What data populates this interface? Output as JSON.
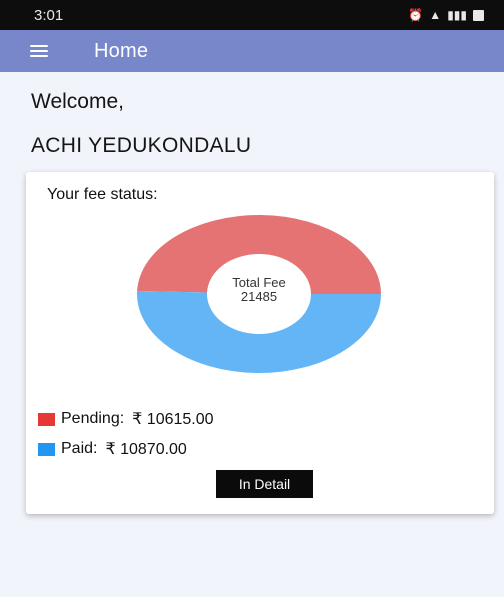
{
  "status_bar": {
    "time": "3:01",
    "icons": [
      "alarm-icon",
      "signal-icon",
      "network-icon",
      "battery-icon"
    ]
  },
  "app_bar": {
    "title": "Home",
    "menu_icon": "hamburger-menu-icon"
  },
  "greeting": {
    "welcome": "Welcome,",
    "name": "ACHI YEDUKONDALU"
  },
  "fee_card": {
    "heading": "Your fee status:",
    "center_label_title": "Total Fee",
    "center_label_value": "21485",
    "legend": [
      {
        "label": "Pending:",
        "amount": "₹ 10615.00",
        "color": "#e57373"
      },
      {
        "label": "Paid:",
        "amount": "₹ 10870.00",
        "color": "#64b5f6"
      }
    ],
    "button_label": "In Detail"
  },
  "chart_data": {
    "type": "pie",
    "donut": true,
    "total": 21485,
    "slices": [
      {
        "name": "Pending",
        "value": 10615.0,
        "color": "#e57373"
      },
      {
        "name": "Paid",
        "value": 10870.0,
        "color": "#64b5f6"
      }
    ]
  }
}
